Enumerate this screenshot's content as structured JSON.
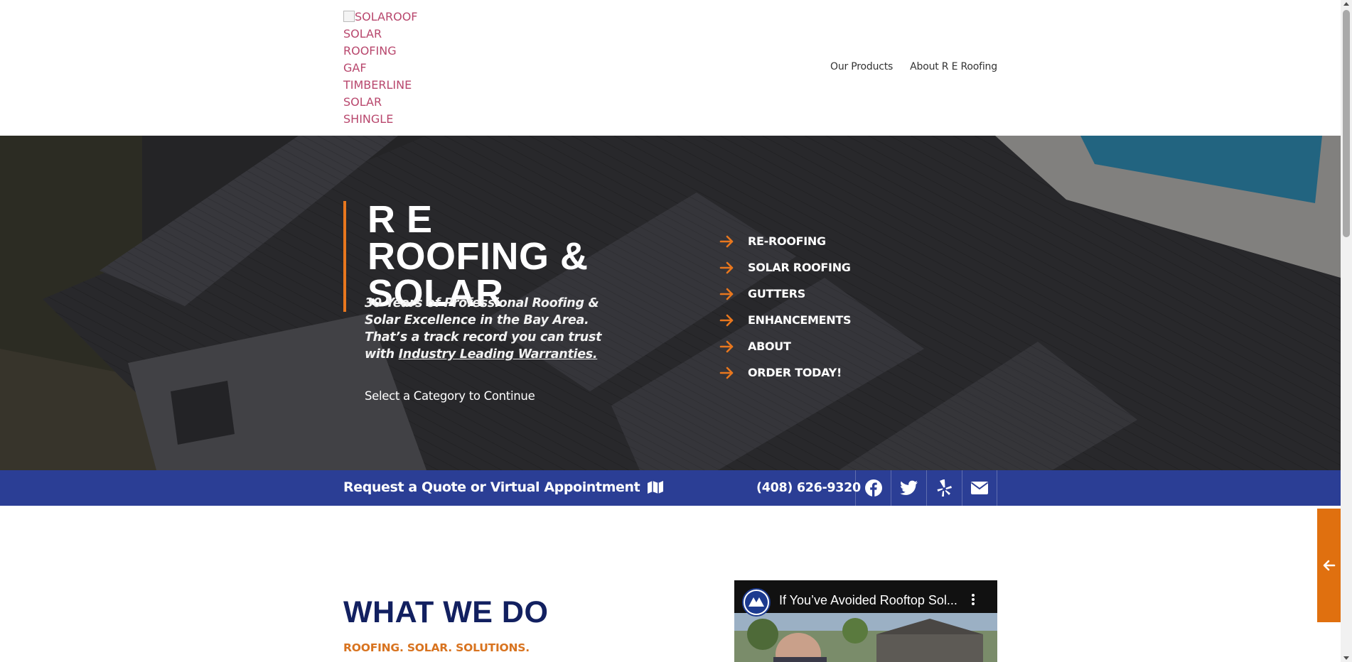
{
  "header": {
    "logo_alt": "SOLAROOF SOLAR ROOFING GAF TIMBERLINE SOLAR SHINGLE",
    "nav": [
      {
        "label": "Our Products"
      },
      {
        "label": "About R E Roofing"
      }
    ]
  },
  "hero": {
    "title": "R E ROOFING & SOLAR",
    "tagline_text": "30 Years of Professional Roofing & Solar Excellence in the Bay Area. That’s a track record you can trust with ",
    "tagline_link": "Industry Leading Warranties.",
    "select_prompt": "Select a Category to Continue",
    "menu": [
      {
        "label": "RE-ROOFING"
      },
      {
        "label": "SOLAR ROOFING"
      },
      {
        "label": "GUTTERS"
      },
      {
        "label": "ENHANCEMENTS"
      },
      {
        "label": "ABOUT"
      },
      {
        "label": "ORDER TODAY!"
      }
    ]
  },
  "bar": {
    "quote_label": "Request a Quote or Virtual Appointment",
    "quote_icon": "map-icon",
    "phone": "(408) 626-9320",
    "socials": [
      {
        "icon": "facebook-icon"
      },
      {
        "icon": "twitter-icon"
      },
      {
        "icon": "yelp-icon"
      },
      {
        "icon": "envelope-icon"
      }
    ]
  },
  "section": {
    "heading": "WHAT WE DO",
    "subheading": "ROOFING. SOLAR. SOLUTIONS."
  },
  "video": {
    "title": "If You’ve Avoided Rooftop Sol..."
  },
  "colors": {
    "accent_orange": "#e8771e",
    "bar_blue": "#2b3e95",
    "heading_navy": "#122060",
    "logo_alt_text": "#b8476d"
  }
}
